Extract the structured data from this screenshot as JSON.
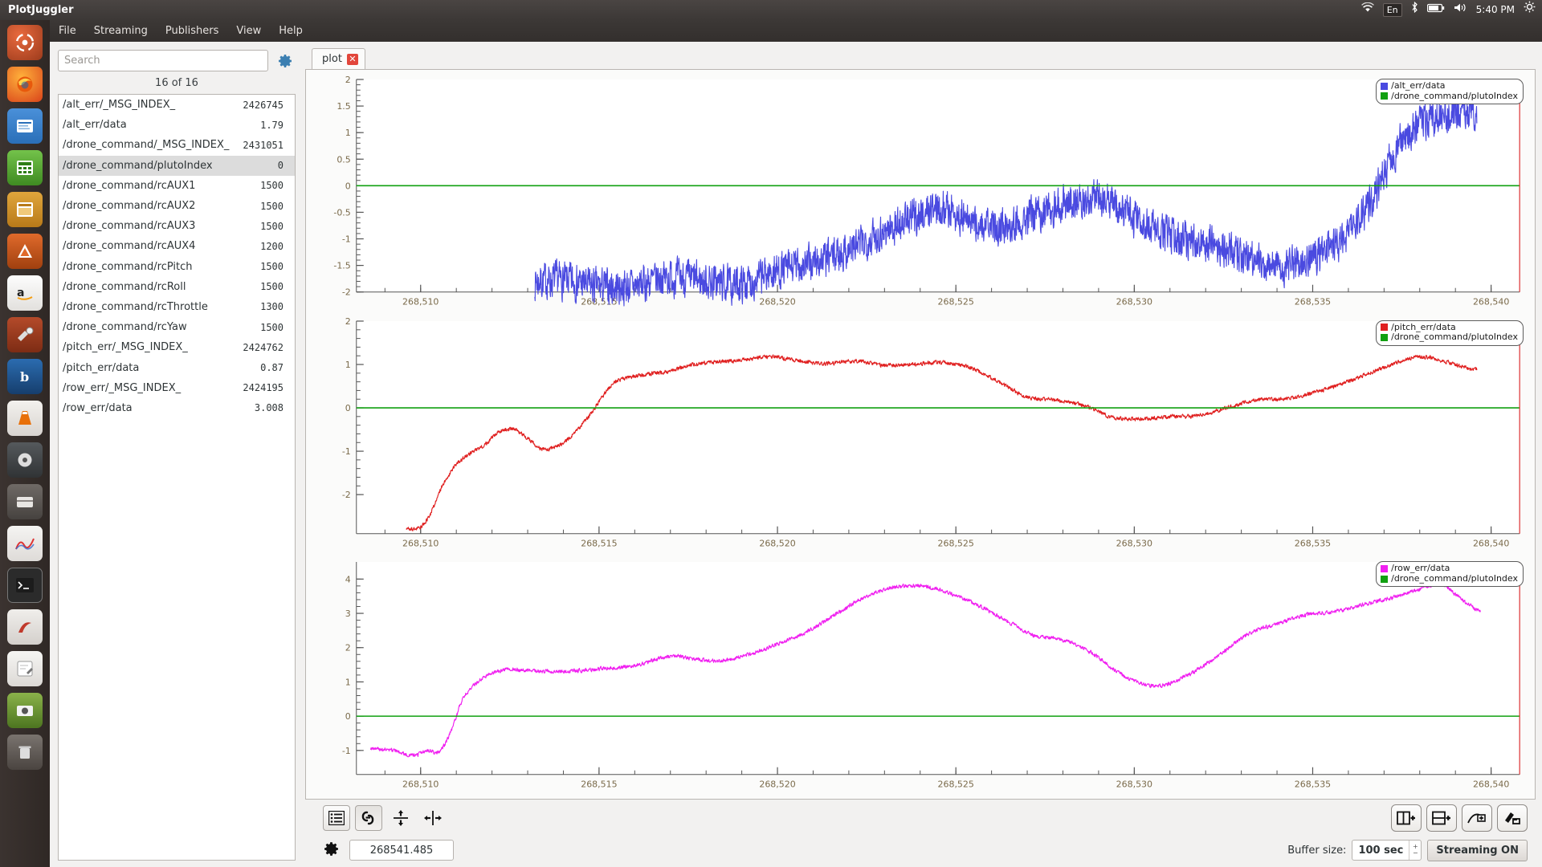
{
  "window": {
    "title": "PlotJuggler"
  },
  "tray": {
    "lang": "En",
    "clock": "5:40 PM"
  },
  "menu": {
    "items": [
      "File",
      "Streaming",
      "Publishers",
      "View",
      "Help"
    ]
  },
  "sidebar": {
    "search": {
      "placeholder": "Search",
      "value": ""
    },
    "count_label": "16 of 16",
    "gear_icon": "gear-icon",
    "curves": [
      {
        "name": "/alt_err/_MSG_INDEX_",
        "value": "2426745",
        "selected": false
      },
      {
        "name": "/alt_err/data",
        "value": "1.79",
        "selected": false
      },
      {
        "name": "/drone_command/_MSG_INDEX_",
        "value": "2431051",
        "selected": false
      },
      {
        "name": "/drone_command/plutoIndex",
        "value": "0",
        "selected": true
      },
      {
        "name": "/drone_command/rcAUX1",
        "value": "1500",
        "selected": false
      },
      {
        "name": "/drone_command/rcAUX2",
        "value": "1500",
        "selected": false
      },
      {
        "name": "/drone_command/rcAUX3",
        "value": "1500",
        "selected": false
      },
      {
        "name": "/drone_command/rcAUX4",
        "value": "1200",
        "selected": false
      },
      {
        "name": "/drone_command/rcPitch",
        "value": "1500",
        "selected": false
      },
      {
        "name": "/drone_command/rcRoll",
        "value": "1500",
        "selected": false
      },
      {
        "name": "/drone_command/rcThrottle",
        "value": "1300",
        "selected": false
      },
      {
        "name": "/drone_command/rcYaw",
        "value": "1500",
        "selected": false
      },
      {
        "name": "/pitch_err/_MSG_INDEX_",
        "value": "2424762",
        "selected": false
      },
      {
        "name": "/pitch_err/data",
        "value": "0.87",
        "selected": false
      },
      {
        "name": "/row_err/_MSG_INDEX_",
        "value": "2424195",
        "selected": false
      },
      {
        "name": "/row_err/data",
        "value": "3.008",
        "selected": false
      }
    ]
  },
  "tabs": [
    {
      "label": "plot",
      "close_icon": "close-icon",
      "active": true
    }
  ],
  "toolbar": {
    "left": [
      {
        "icon": "list-view-icon",
        "pressed": false,
        "framed": true
      },
      {
        "icon": "link-curves-icon",
        "pressed": true,
        "framed": true
      },
      {
        "icon": "zoom-vertical-icon",
        "pressed": false,
        "framed": false
      },
      {
        "icon": "zoom-horizontal-icon",
        "pressed": false,
        "framed": false
      }
    ],
    "right": [
      {
        "icon": "split-horizontal-icon"
      },
      {
        "icon": "split-vertical-icon"
      },
      {
        "icon": "add-plot-icon"
      },
      {
        "icon": "clear-plot-icon"
      }
    ]
  },
  "statusbar": {
    "gear_icon": "gear-icon",
    "time_value": "268541.485",
    "buffer_label": "Buffer size:",
    "buffer_value": "100 sec",
    "streaming_label": "Streaming ON"
  },
  "colors": {
    "alt_err": "#4a4ae0",
    "pitch_err": "#e02020",
    "row_err": "#f020f0",
    "pluto_index": "#11a011",
    "grid": "#cfcfcf",
    "axis": "#555555"
  },
  "chart_data": [
    {
      "type": "line",
      "id": "plot-alt-err",
      "title": "",
      "xlabel": "",
      "ylabel": "",
      "xlim": [
        268508.2,
        268540.8
      ],
      "ylim": [
        -2,
        2
      ],
      "xticks": [
        268510,
        268515,
        268520,
        268525,
        268530,
        268535,
        268540
      ],
      "xticklabels": [
        "268,510",
        "268,515",
        "268,520",
        "268,525",
        "268,530",
        "268,535",
        "268,540"
      ],
      "yticks": [
        -2,
        -1.5,
        -1,
        -0.5,
        0,
        0.5,
        1,
        1.5,
        2
      ],
      "yticklabels": [
        "-2",
        "-1.5",
        "-1",
        "-0.5",
        "0",
        "0.5",
        "1",
        "1.5",
        "2"
      ],
      "grid": false,
      "legend_position": "top-right",
      "series": [
        {
          "name": "/alt_err/data",
          "color": "#4a4ae0",
          "noise": 0.3,
          "x": [
            268513.2,
            268514.0,
            268515.0,
            268516.0,
            268517.0,
            268518.0,
            268519.0,
            268520.0,
            268521.0,
            268522.0,
            268523.0,
            268524.0,
            268524.6,
            268525.2,
            268526.0,
            268527.0,
            268528.0,
            268529.0,
            268529.6,
            268530.2,
            268531.0,
            268532.0,
            268533.0,
            268534.0,
            268535.0,
            268535.8,
            268536.6,
            268537.2,
            268537.8,
            268538.4,
            268539.0,
            268539.6
          ],
          "y": [
            -1.8,
            -1.78,
            -1.9,
            -1.88,
            -1.72,
            -1.8,
            -1.85,
            -1.6,
            -1.45,
            -1.2,
            -0.85,
            -0.55,
            -0.4,
            -0.62,
            -0.78,
            -0.6,
            -0.35,
            -0.22,
            -0.45,
            -0.7,
            -0.95,
            -1.05,
            -1.28,
            -1.5,
            -1.35,
            -1.0,
            -0.35,
            0.55,
            1.05,
            1.3,
            1.35,
            1.4
          ]
        },
        {
          "name": "/drone_command/plutoIndex",
          "color": "#11a011",
          "constant": 0
        }
      ]
    },
    {
      "type": "line",
      "id": "plot-pitch-err",
      "title": "",
      "xlabel": "",
      "ylabel": "",
      "xlim": [
        268508.2,
        268540.8
      ],
      "ylim": [
        -2.9,
        2
      ],
      "xticks": [
        268510,
        268515,
        268520,
        268525,
        268530,
        268535,
        268540
      ],
      "xticklabels": [
        "268,510",
        "268,515",
        "268,520",
        "268,525",
        "268,530",
        "268,535",
        "268,540"
      ],
      "yticks": [
        -2,
        -1,
        0,
        1,
        2
      ],
      "yticklabels": [
        "-2",
        "-1",
        "0",
        "1",
        "2"
      ],
      "grid": false,
      "legend_position": "top-right",
      "series": [
        {
          "name": "/pitch_err/data",
          "color": "#e02020",
          "noise": 0.04,
          "x": [
            268509.6,
            268510.0,
            268510.3,
            268510.6,
            268511.0,
            268511.4,
            268511.8,
            268512.2,
            268512.6,
            268513.0,
            268513.4,
            268514.0,
            268514.6,
            268515.4,
            268516.2,
            268517.0,
            268517.6,
            268518.2,
            268519.0,
            268519.8,
            268520.6,
            268521.4,
            268522.2,
            268523.0,
            268523.8,
            268524.6,
            268525.4,
            268526.2,
            268527.0,
            268527.8,
            268528.6,
            268529.4,
            268530.2,
            268531.0,
            268531.8,
            268532.6,
            268533.4,
            268534.2,
            268535.0,
            268535.8,
            268536.6,
            268537.4,
            268538.0,
            268538.6,
            268539.2,
            268539.6
          ],
          "y": [
            -2.78,
            -2.75,
            -2.4,
            -1.8,
            -1.3,
            -1.05,
            -0.85,
            -0.55,
            -0.5,
            -0.7,
            -0.95,
            -0.8,
            -0.3,
            0.55,
            0.75,
            0.85,
            1.0,
            1.05,
            1.1,
            1.18,
            1.08,
            1.02,
            1.08,
            0.98,
            1.0,
            1.05,
            0.92,
            0.6,
            0.25,
            0.18,
            0.05,
            -0.22,
            -0.25,
            -0.2,
            -0.18,
            0.0,
            0.18,
            0.2,
            0.35,
            0.55,
            0.8,
            1.05,
            1.18,
            1.1,
            0.95,
            0.88
          ]
        },
        {
          "name": "/drone_command/plutoIndex",
          "color": "#11a011",
          "constant": 0
        }
      ]
    },
    {
      "type": "line",
      "id": "plot-row-err",
      "title": "",
      "xlabel": "",
      "ylabel": "",
      "xlim": [
        268508.2,
        268540.8
      ],
      "ylim": [
        -1.7,
        4.5
      ],
      "xticks": [
        268510,
        268515,
        268520,
        268525,
        268530,
        268535,
        268540
      ],
      "xticklabels": [
        "268,510",
        "268,515",
        "268,520",
        "268,525",
        "268,530",
        "268,535",
        "268,540"
      ],
      "yticks": [
        -1,
        0,
        1,
        2,
        3,
        4
      ],
      "yticklabels": [
        "-1",
        "0",
        "1",
        "2",
        "3",
        "4"
      ],
      "grid": false,
      "legend_position": "top-right",
      "series": [
        {
          "name": "/row_err/data",
          "color": "#f020f0",
          "noise": 0.05,
          "x": [
            268508.6,
            268509.2,
            268509.8,
            268510.2,
            268510.5,
            268510.8,
            268511.2,
            268511.8,
            268512.4,
            268513.2,
            268514.0,
            268515.0,
            268516.0,
            268517.0,
            268517.8,
            268518.4,
            268519.2,
            268520.0,
            268520.8,
            268521.6,
            268522.4,
            268523.2,
            268524.0,
            268524.8,
            268525.6,
            268526.4,
            268527.2,
            268528.0,
            268528.8,
            268529.6,
            268530.2,
            268530.8,
            268531.6,
            268532.4,
            268533.2,
            268534.0,
            268534.8,
            268535.6,
            268536.4,
            268537.2,
            268538.0,
            268538.6,
            268539.0,
            268539.4,
            268539.7
          ],
          "y": [
            -0.95,
            -1.0,
            -1.15,
            -1.0,
            -1.05,
            -0.55,
            0.55,
            1.15,
            1.35,
            1.32,
            1.3,
            1.38,
            1.48,
            1.75,
            1.65,
            1.62,
            1.8,
            2.1,
            2.45,
            2.95,
            3.45,
            3.75,
            3.8,
            3.6,
            3.25,
            2.8,
            2.35,
            2.22,
            1.85,
            1.25,
            0.95,
            0.9,
            1.25,
            1.8,
            2.4,
            2.7,
            2.95,
            3.05,
            3.25,
            3.45,
            3.7,
            3.85,
            3.55,
            3.25,
            3.05
          ]
        },
        {
          "name": "/drone_command/plutoIndex",
          "color": "#11a011",
          "constant": 0
        }
      ]
    }
  ]
}
